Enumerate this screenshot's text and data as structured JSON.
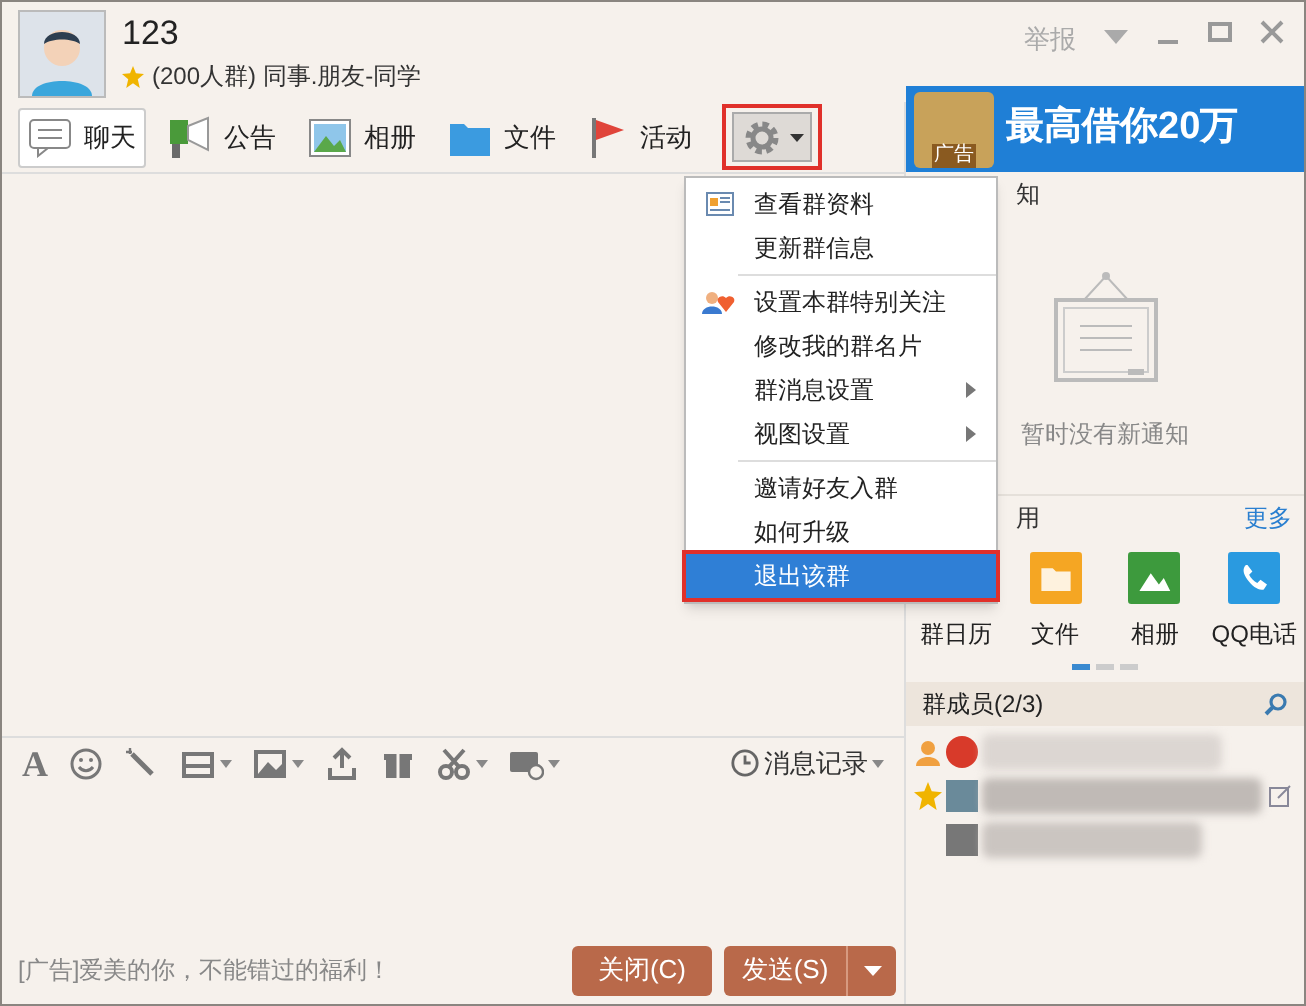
{
  "group": {
    "name": "123",
    "info": "(200人群) 同事.朋友-同学",
    "report": "举报"
  },
  "tabs": [
    {
      "label": "聊天",
      "kind": "chat",
      "selected": true
    },
    {
      "label": "公告",
      "kind": "announce",
      "selected": false
    },
    {
      "label": "相册",
      "kind": "photo",
      "selected": false
    },
    {
      "label": "文件",
      "kind": "folder",
      "selected": false
    },
    {
      "label": "活动",
      "kind": "event",
      "selected": false
    }
  ],
  "ad_banner": {
    "badge": "广告",
    "text": "最高借你20万"
  },
  "menu": {
    "items": [
      {
        "kind": "info",
        "label": "查看群资料",
        "submenu": false,
        "selected": false
      },
      {
        "kind": "plain",
        "label": "更新群信息",
        "submenu": false,
        "selected": false
      },
      {
        "kind": "separator"
      },
      {
        "kind": "follow",
        "label": "设置本群特别关注",
        "submenu": false,
        "selected": false
      },
      {
        "kind": "plain",
        "label": "修改我的群名片",
        "submenu": false,
        "selected": false
      },
      {
        "kind": "plain",
        "label": "群消息设置",
        "submenu": true,
        "selected": false
      },
      {
        "kind": "plain",
        "label": "视图设置",
        "submenu": true,
        "selected": false
      },
      {
        "kind": "separator"
      },
      {
        "kind": "plain",
        "label": "邀请好友入群",
        "submenu": false,
        "selected": false
      },
      {
        "kind": "plain",
        "label": "如何升级",
        "submenu": false,
        "selected": false
      },
      {
        "kind": "plain",
        "label": "退出该群",
        "submenu": false,
        "selected": true
      }
    ]
  },
  "notice": {
    "header": "知",
    "empty": "暂时没有新通知"
  },
  "apps": {
    "header": "用",
    "more": "更多",
    "items": [
      {
        "label": "群日历",
        "kind": "calendar"
      },
      {
        "label": "文件",
        "kind": "folder"
      },
      {
        "label": "相册",
        "kind": "photo"
      },
      {
        "label": "QQ电话",
        "kind": "phone"
      }
    ]
  },
  "members": {
    "header": "群成员(2/3)"
  },
  "font_button": "A",
  "history": "消息记录",
  "ad_line": "[广告]爱美的你，不能错过的福利！",
  "buttons": {
    "close": "关闭(C)",
    "send": "发送(S)"
  }
}
